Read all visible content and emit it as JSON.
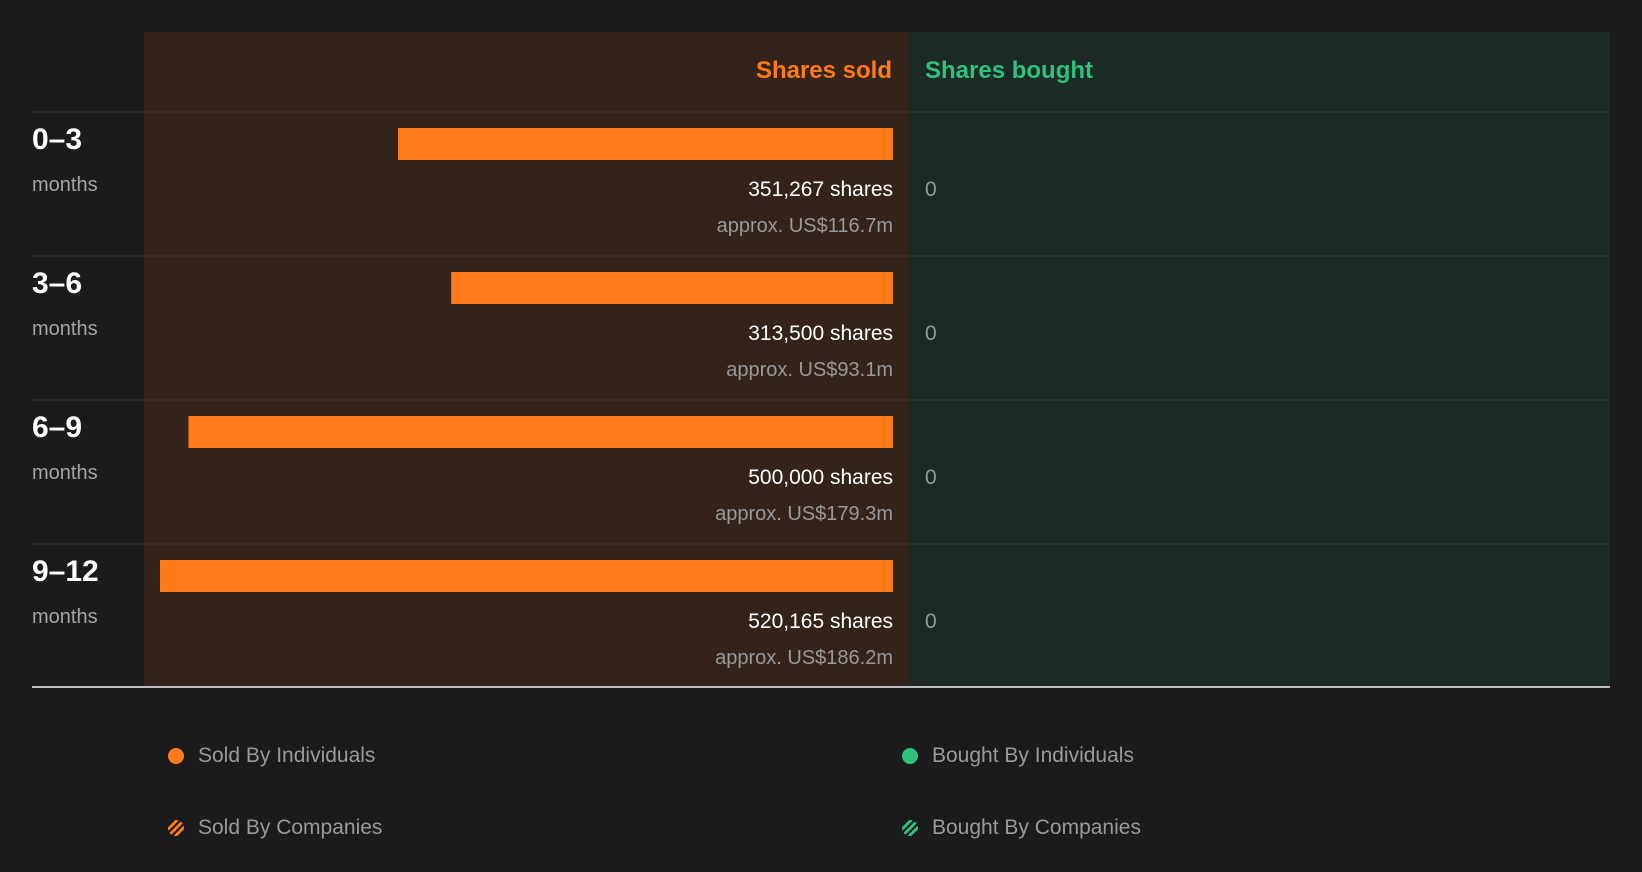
{
  "colors": {
    "background": "#1b1b1b",
    "sold_panel": "#33231b",
    "bought_panel": "#1b2a24",
    "sold": "#ff7a1a",
    "bought": "#2ec27e",
    "divider": "#3a3a3a",
    "baseline": "#bdbdbd"
  },
  "chart_data": {
    "type": "bar",
    "orientation": "horizontal-diverging",
    "headers": {
      "sold": "Shares sold",
      "bought": "Shares bought"
    },
    "unit_label": "months",
    "rows": [
      {
        "range": "0–3",
        "sold": 351267,
        "sold_label": "351,267 shares",
        "sold_value": "approx. US$116.7m",
        "bought": 0,
        "bought_label": "0"
      },
      {
        "range": "3–6",
        "sold": 313500,
        "sold_label": "313,500 shares",
        "sold_value": "approx. US$93.1m",
        "bought": 0,
        "bought_label": "0"
      },
      {
        "range": "6–9",
        "sold": 500000,
        "sold_label": "500,000 shares",
        "sold_value": "approx. US$179.3m",
        "bought": 0,
        "bought_label": "0"
      },
      {
        "range": "9–12",
        "sold": 520165,
        "sold_label": "520,165 shares",
        "sold_value": "approx. US$186.2m",
        "bought": 0,
        "bought_label": "0"
      }
    ]
  },
  "legend": [
    {
      "label": "Sold By Individuals",
      "marker": "solid-sold"
    },
    {
      "label": "Bought By Individuals",
      "marker": "solid-bought"
    },
    {
      "label": "Sold By Companies",
      "marker": "striped-sold"
    },
    {
      "label": "Bought By Companies",
      "marker": "striped-bought"
    }
  ]
}
